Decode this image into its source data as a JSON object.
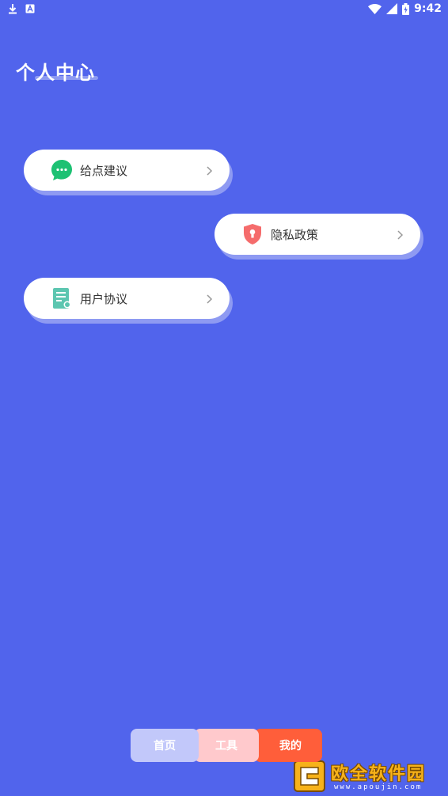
{
  "status_bar": {
    "time": "9:42",
    "left_icons": [
      "download-icon",
      "a-box-icon"
    ],
    "right_icons": [
      "wifi-icon",
      "signal-icon",
      "battery-icon"
    ]
  },
  "page": {
    "title": "个人中心"
  },
  "menu": [
    {
      "label": "给点建议",
      "icon": "chat-bubble-icon",
      "icon_color": "#1DC173"
    },
    {
      "label": "隐私政策",
      "icon": "shield-icon",
      "icon_color": "#F56C6C"
    },
    {
      "label": "用户协议",
      "icon": "document-icon",
      "icon_color": "#5CC6B0"
    }
  ],
  "bottom_nav": {
    "tabs": [
      {
        "label": "首页",
        "color": "#C2C8FA"
      },
      {
        "label": "工具",
        "color": "#FFC9CC"
      },
      {
        "label": "我的",
        "color": "#FF5E3A",
        "active": true
      }
    ]
  },
  "watermark": {
    "name": "欧全软件园",
    "url": "www.apoujin.com"
  },
  "colors": {
    "background": "#5164EC",
    "card": "#FFFFFF",
    "card_shadow": "#8E9AF2"
  }
}
